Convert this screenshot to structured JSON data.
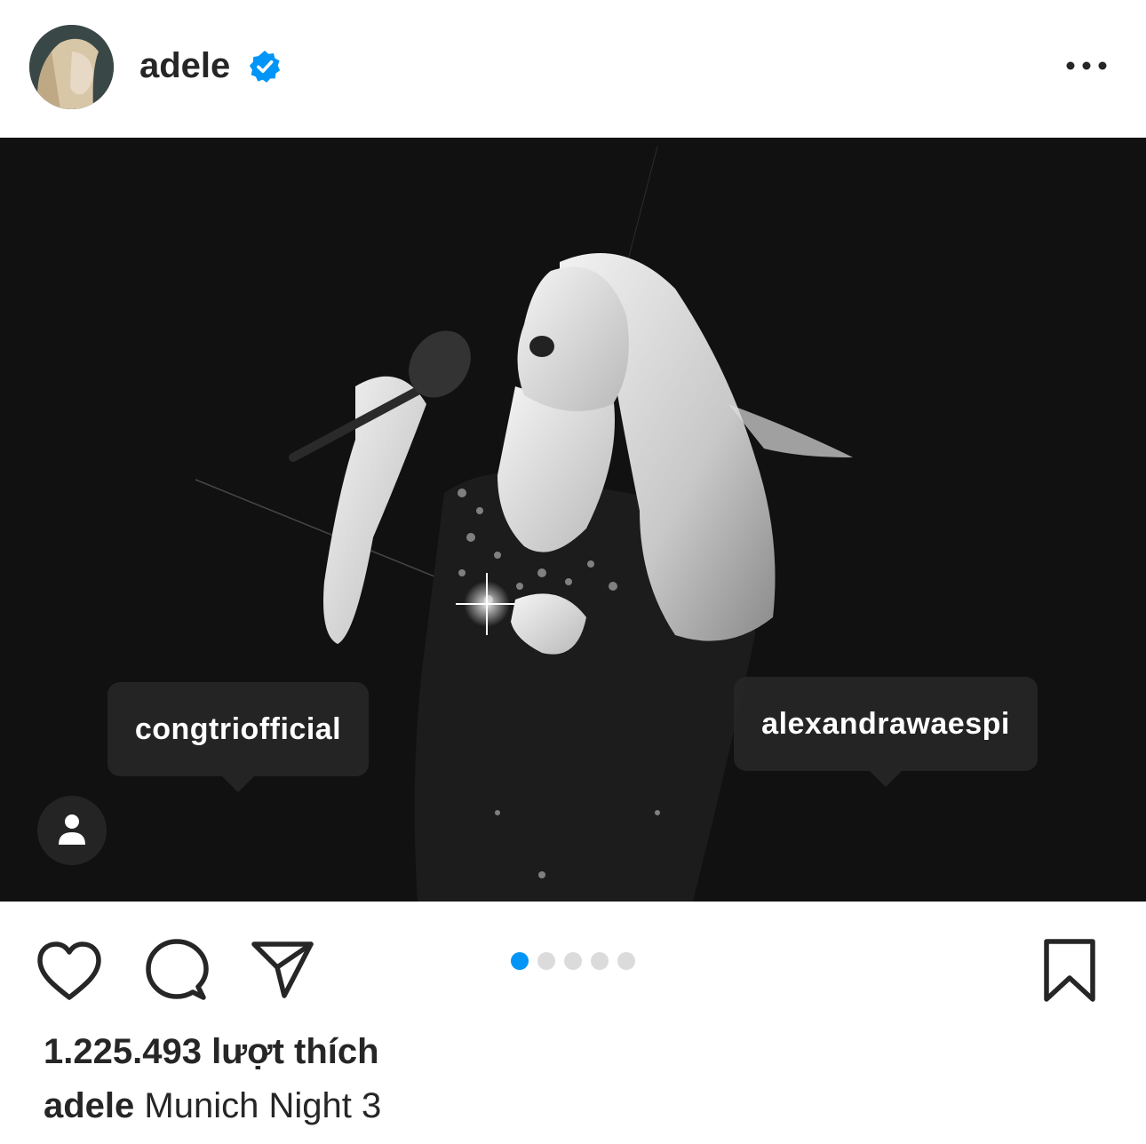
{
  "post": {
    "username": "adele",
    "verified": true,
    "verified_icon": "verified-badge-icon",
    "more_icon": "more-options-icon",
    "accent_color": "#0095f6"
  },
  "tags": [
    {
      "username": "congtriofficial"
    },
    {
      "username": "alexandrawaespi"
    }
  ],
  "actions": {
    "like_icon": "heart-icon",
    "comment_icon": "comment-icon",
    "share_icon": "paper-plane-icon",
    "save_icon": "bookmark-icon"
  },
  "carousel": {
    "total": 5,
    "active_index": 0
  },
  "likes_text": "1.225.493 lượt thích",
  "caption": {
    "username": "adele",
    "text": "Munich Night 3"
  }
}
